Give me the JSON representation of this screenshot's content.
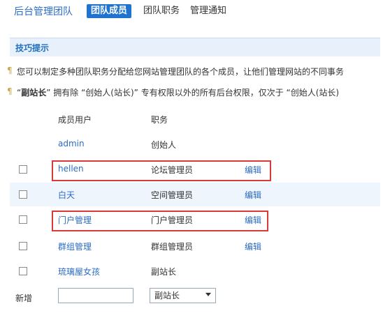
{
  "header": {
    "title": "后台管理团队",
    "tabs": [
      {
        "label": "团队成员",
        "active": true
      },
      {
        "label": "团队职务",
        "active": false
      },
      {
        "label": "管理通知",
        "active": false
      }
    ]
  },
  "tips": {
    "title": "技巧提示",
    "items": [
      {
        "text": "您可以制定多种团队职务分配给您网站管理团队的各个成员，让他们管理网站的不同事务"
      },
      {
        "prefix": "“",
        "bold": "副站长",
        "rest": "” 拥有除 “创始人(站长)” 专有权限以外的所有后台权限，仅次于 “创始人(站长)"
      }
    ]
  },
  "table": {
    "headers": {
      "member": "成员用户",
      "role": "职务"
    },
    "rows": [
      {
        "member": "admin",
        "role": "创始人",
        "edit": ""
      },
      {
        "member": "hellen",
        "role": "论坛管理员",
        "edit": "编辑"
      },
      {
        "member": "白天",
        "role": "空间管理员",
        "edit": "编辑"
      },
      {
        "member": "门户管理",
        "role": "门户管理员",
        "edit": "编辑"
      },
      {
        "member": "群组管理",
        "role": "群组管理员",
        "edit": "编辑"
      },
      {
        "member": "琉璃屋女孩",
        "role": "副站长",
        "edit": ""
      }
    ]
  },
  "new_member": {
    "label": "新增",
    "input_value": "",
    "select_value": "副站长"
  },
  "colors": {
    "accent": "#1f73ce",
    "link": "#2b6cc4",
    "highlight": "#d83a3a"
  }
}
